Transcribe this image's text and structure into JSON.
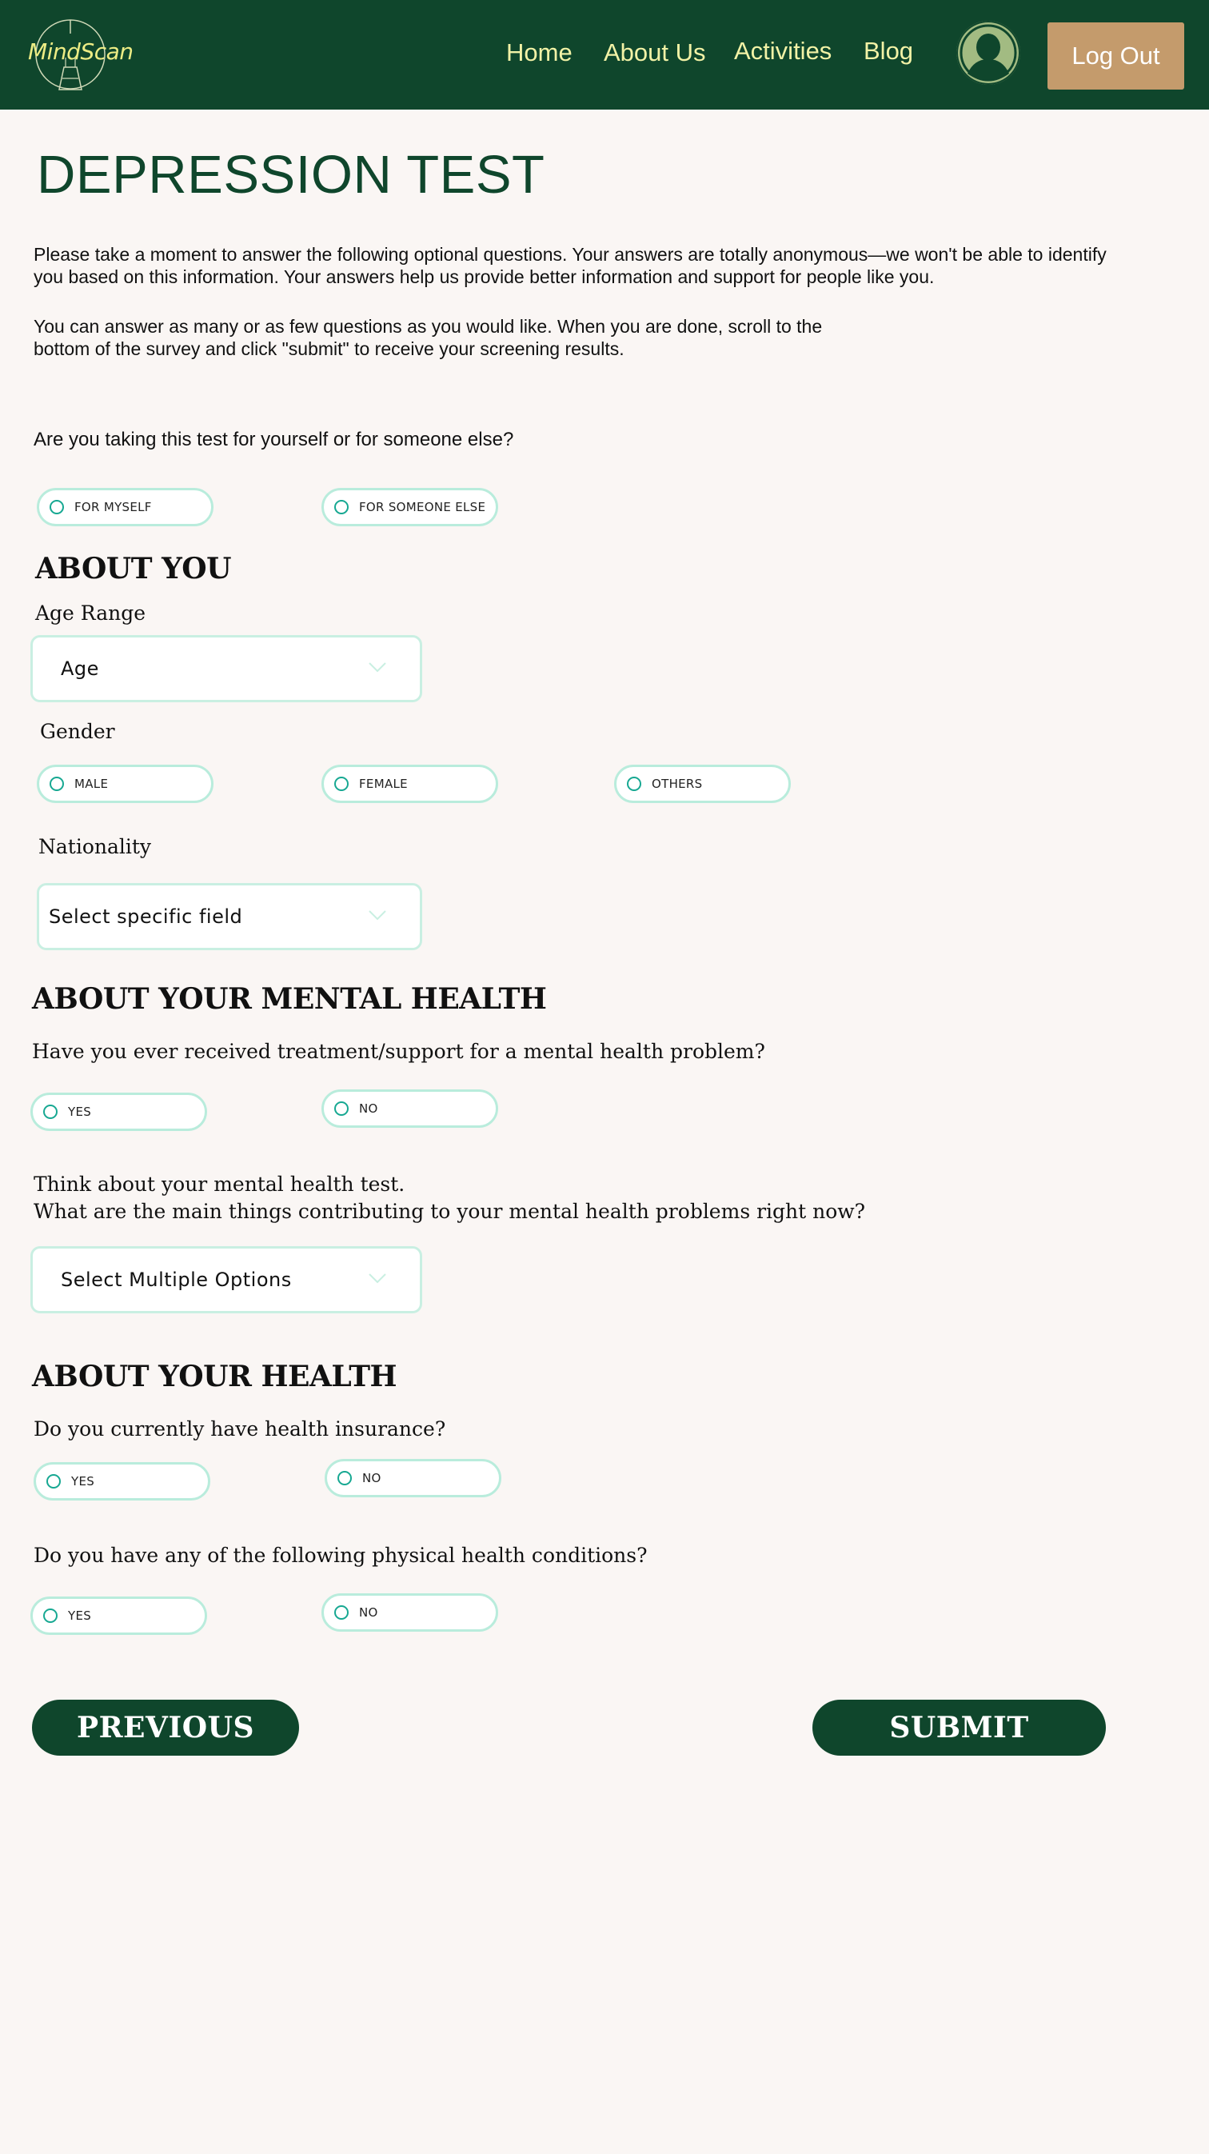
{
  "header": {
    "logo_text": "MindScan",
    "nav": [
      "Home",
      "About Us",
      "Activities",
      "Blog"
    ],
    "logout_label": "Log Out"
  },
  "page": {
    "title": "DEPRESSION TEST",
    "intro_1": "Please take a moment to answer the following optional questions. Your answers are totally anonymous—we won't be able to identify you based on this information. Your answers help us provide better information and support for people like you.",
    "intro_2": "You can answer as many or as few questions as you would like. When you are done, scroll to the bottom of the survey and click \"submit\" to receive your screening results."
  },
  "taker": {
    "question": "Are you taking this test for yourself or for someone else?",
    "options": [
      "FOR MYSELF",
      "FOR SOMEONE ELSE"
    ]
  },
  "about_you": {
    "heading": "ABOUT YOU",
    "age_label": "Age Range",
    "age_value": "Age",
    "gender_label": "Gender",
    "gender_options": [
      "MALE",
      "FEMALE",
      "OTHERS"
    ],
    "nationality_label": "Nationality",
    "nationality_value": "Select specific field"
  },
  "mental_health": {
    "heading": "ABOUT YOUR MENTAL HEALTH",
    "treatment_question": "Have you ever received treatment/support for a mental health problem?",
    "treatment_options": [
      "YES",
      "NO"
    ],
    "think_line_1": "Think about your mental health test.",
    "think_line_2": "What are the main things contributing to your mental health problems right now?",
    "contributors_value": "Select Multiple Options"
  },
  "health": {
    "heading": "ABOUT YOUR HEALTH",
    "insurance_question": "Do you currently have health insurance?",
    "insurance_options": [
      "YES",
      "NO"
    ],
    "conditions_question": "Do you have any of the following physical health conditions?",
    "conditions_options": [
      "YES",
      "NO"
    ]
  },
  "actions": {
    "previous_label": "PREVIOUS",
    "submit_label": "SUBMIT"
  },
  "colors": {
    "header_bg": "#0f462c",
    "nav_text": "#f2f2a6",
    "logout_bg": "#c49b6c",
    "title": "#0f462c",
    "pill_border": "#b9ecdc",
    "radio": "#17a892",
    "page_bg": "#faf6f4"
  },
  "icons": [
    "mindscan-logo-icon",
    "user-avatar-icon",
    "chevron-down-icon",
    "radio-icon"
  ]
}
